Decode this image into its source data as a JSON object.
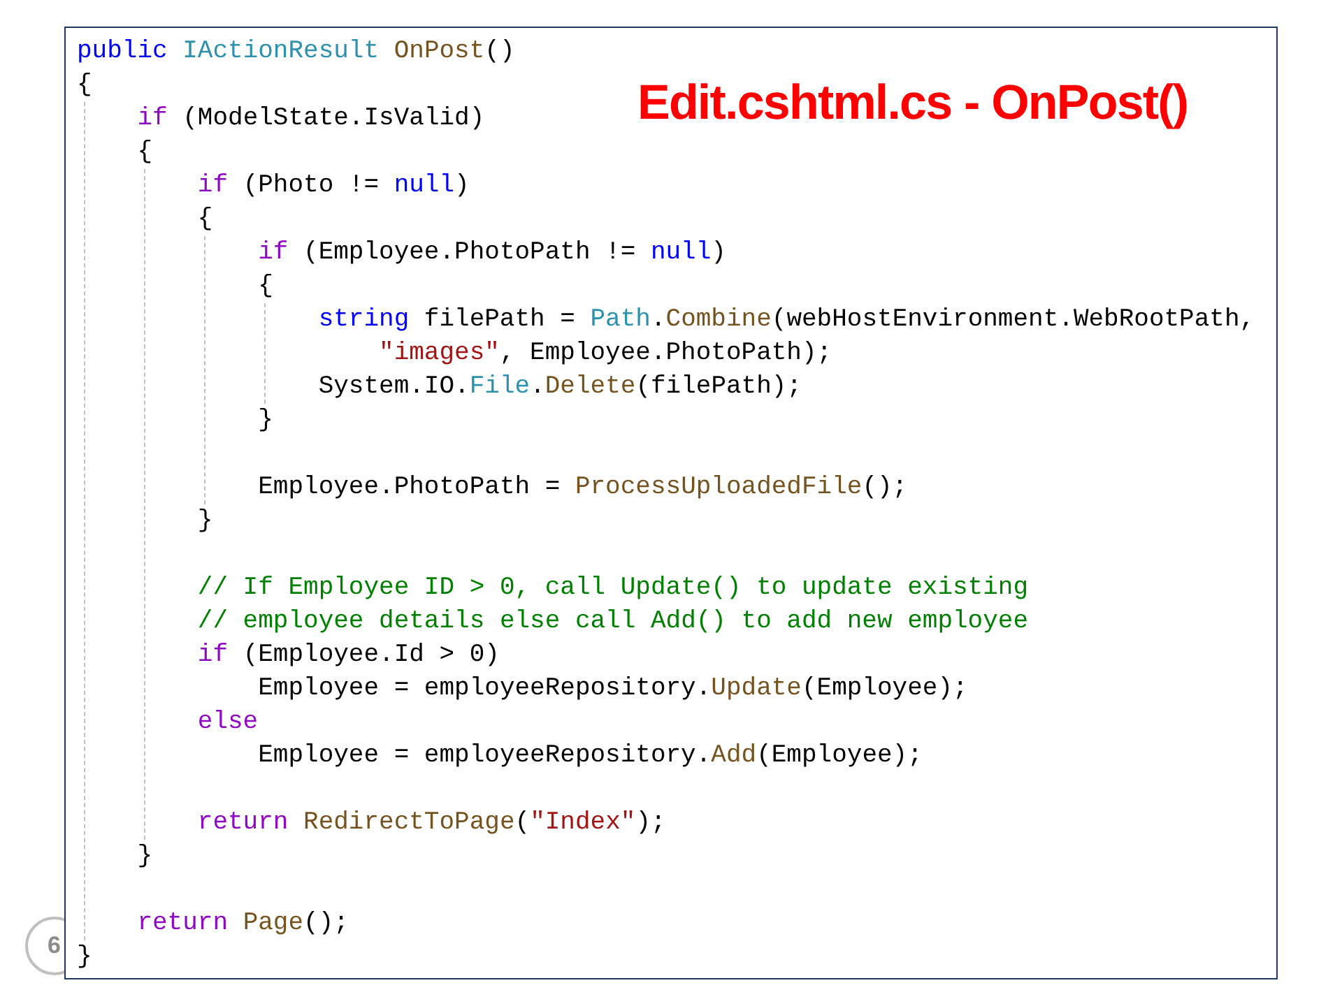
{
  "title": "Edit.cshtml.cs - OnPost()",
  "slide_number": "6",
  "code": [
    {
      "kind": "code",
      "tokens": [
        {
          "t": "public",
          "kind": "keyword"
        },
        {
          "t": "IActionResult",
          "kind": "type",
          "space_before": true
        },
        {
          "t": "OnPost",
          "kind": "method",
          "space_before": true
        },
        {
          "t": "()"
        }
      ]
    },
    {
      "kind": "code",
      "tokens": [
        {
          "t": "{"
        }
      ],
      "guide": true,
      "children": [
        {
          "kind": "code",
          "tokens": [
            {
              "t": "if",
              "kind": "control"
            },
            {
              "t": "(ModelState.IsValid)",
              "space_before": true
            }
          ]
        },
        {
          "kind": "code",
          "tokens": [
            {
              "t": "{"
            }
          ],
          "guide": true,
          "children": [
            {
              "kind": "code",
              "tokens": [
                {
                  "t": "if",
                  "kind": "control"
                },
                {
                  "t": "(Photo !=",
                  "space_before": true
                },
                {
                  "t": "null",
                  "kind": "keyword",
                  "space_before": true
                },
                {
                  "t": ")"
                }
              ]
            },
            {
              "kind": "code",
              "tokens": [
                {
                  "t": "{"
                }
              ],
              "guide": true,
              "children": [
                {
                  "kind": "code",
                  "tokens": [
                    {
                      "t": "if",
                      "kind": "control"
                    },
                    {
                      "t": "(Employee.PhotoPath !=",
                      "space_before": true
                    },
                    {
                      "t": "null",
                      "kind": "keyword",
                      "space_before": true
                    },
                    {
                      "t": ")"
                    }
                  ]
                },
                {
                  "kind": "code",
                  "tokens": [
                    {
                      "t": "{"
                    }
                  ],
                  "guide": true,
                  "children": [
                    {
                      "kind": "code",
                      "tokens": [
                        {
                          "t": "string",
                          "kind": "keyword"
                        },
                        {
                          "t": "filePath =",
                          "space_before": true
                        },
                        {
                          "t": "Path",
                          "kind": "type",
                          "space_before": true
                        },
                        {
                          "t": "."
                        },
                        {
                          "t": "Combine",
                          "kind": "method"
                        },
                        {
                          "t": "(webHostEnvironment.WebRootPath,"
                        }
                      ],
                      "children": [
                        {
                          "kind": "code",
                          "tokens": [
                            {
                              "t": "\"images\"",
                              "kind": "string"
                            },
                            {
                              "t": ", Employee.PhotoPath);"
                            }
                          ]
                        }
                      ]
                    },
                    {
                      "kind": "code",
                      "tokens": [
                        {
                          "t": "System.IO."
                        },
                        {
                          "t": "File",
                          "kind": "type"
                        },
                        {
                          "t": "."
                        },
                        {
                          "t": "Delete",
                          "kind": "method"
                        },
                        {
                          "t": "(filePath);"
                        }
                      ]
                    }
                  ]
                },
                {
                  "kind": "code",
                  "tokens": [
                    {
                      "t": "}"
                    }
                  ]
                },
                {
                  "kind": "blank"
                },
                {
                  "kind": "code",
                  "tokens": [
                    {
                      "t": "Employee.PhotoPath ="
                    },
                    {
                      "t": "ProcessUploadedFile",
                      "kind": "method",
                      "space_before": true
                    },
                    {
                      "t": "();"
                    }
                  ]
                }
              ]
            },
            {
              "kind": "code",
              "tokens": [
                {
                  "t": "}"
                }
              ]
            },
            {
              "kind": "blank"
            },
            {
              "kind": "code",
              "tokens": [
                {
                  "t": "// If Employee ID > 0, call Update() to update existing",
                  "kind": "comment"
                }
              ]
            },
            {
              "kind": "code",
              "tokens": [
                {
                  "t": "// employee details else call Add() to add new employee",
                  "kind": "comment"
                }
              ]
            },
            {
              "kind": "code",
              "tokens": [
                {
                  "t": "if",
                  "kind": "control"
                },
                {
                  "t": "(Employee.Id > 0)",
                  "space_before": true
                }
              ],
              "children": [
                {
                  "kind": "code",
                  "tokens": [
                    {
                      "t": "Employee = employeeRepository."
                    },
                    {
                      "t": "Update",
                      "kind": "method"
                    },
                    {
                      "t": "(Employee);"
                    }
                  ]
                }
              ]
            },
            {
              "kind": "code",
              "tokens": [
                {
                  "t": "else",
                  "kind": "control"
                }
              ],
              "children": [
                {
                  "kind": "code",
                  "tokens": [
                    {
                      "t": "Employee = employeeRepository."
                    },
                    {
                      "t": "Add",
                      "kind": "method"
                    },
                    {
                      "t": "(Employee);"
                    }
                  ]
                }
              ]
            },
            {
              "kind": "blank"
            },
            {
              "kind": "code",
              "tokens": [
                {
                  "t": "return",
                  "kind": "control"
                },
                {
                  "t": "RedirectToPage",
                  "kind": "method",
                  "space_before": true
                },
                {
                  "t": "("
                },
                {
                  "t": "\"Index\"",
                  "kind": "string"
                },
                {
                  "t": ");"
                }
              ]
            }
          ]
        },
        {
          "kind": "code",
          "tokens": [
            {
              "t": "}"
            }
          ]
        },
        {
          "kind": "blank"
        },
        {
          "kind": "code",
          "tokens": [
            {
              "t": "return",
              "kind": "control"
            },
            {
              "t": "Page",
              "kind": "method",
              "space_before": true
            },
            {
              "t": "();"
            }
          ]
        }
      ]
    },
    {
      "kind": "code",
      "tokens": [
        {
          "t": "}"
        }
      ]
    }
  ]
}
